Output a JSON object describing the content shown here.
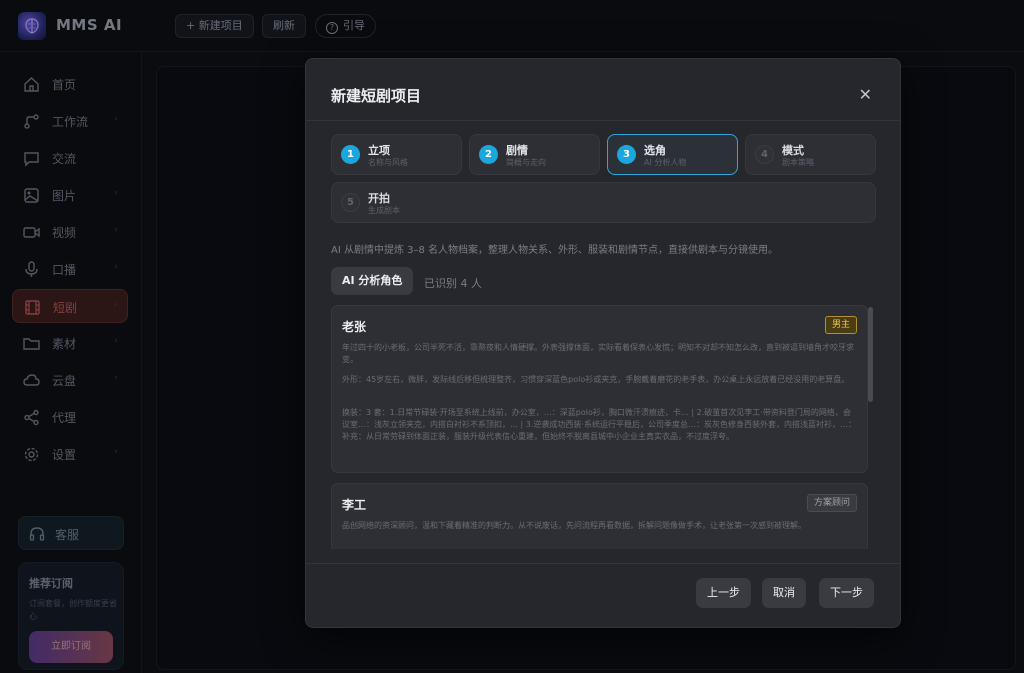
{
  "app": {
    "name": "MMS AI",
    "toolbar": {
      "new_project": "+ 新建项目",
      "refresh": "刷新",
      "guide": "引导"
    }
  },
  "sidebar": {
    "items": [
      {
        "label": "首页",
        "icon": "home-icon"
      },
      {
        "label": "工作流",
        "icon": "workflow-icon"
      },
      {
        "label": "交流",
        "icon": "chat-icon"
      },
      {
        "label": "图片",
        "icon": "image-icon"
      },
      {
        "label": "视频",
        "icon": "video-icon"
      },
      {
        "label": "口播",
        "icon": "microphone-icon"
      },
      {
        "label": "短剧",
        "icon": "film-icon",
        "active": true
      },
      {
        "label": "素材",
        "icon": "folder-icon"
      },
      {
        "label": "云盘",
        "icon": "cloud-icon"
      },
      {
        "label": "代理",
        "icon": "share-icon"
      },
      {
        "label": "设置",
        "icon": "gear-icon"
      }
    ],
    "service": "客服",
    "subscription": {
      "title": "推荐订阅",
      "desc": "订阅套餐，创作额度更省心",
      "button": "立即订阅"
    }
  },
  "modal": {
    "title": "新建短剧项目",
    "steps": [
      {
        "num": "1",
        "title": "立项",
        "sub": "名称与风格",
        "state": "done"
      },
      {
        "num": "2",
        "title": "剧情",
        "sub": "简概与走向",
        "state": "done"
      },
      {
        "num": "3",
        "title": "选角",
        "sub": "AI 分析人物",
        "state": "active"
      },
      {
        "num": "4",
        "title": "模式",
        "sub": "剧本策略",
        "state": "pending"
      },
      {
        "num": "5",
        "title": "开拍",
        "sub": "生成剧本",
        "state": "pending"
      }
    ],
    "intro": "AI 从剧情中提炼 3–8 名人物档案，整理人物关系、外形、服装和剧情节点，直接供剧本与分镜使用。",
    "tab_label": "AI 分析角色",
    "tab_count": "已识别 4 人",
    "characters": [
      {
        "name": "老张",
        "role": "男主",
        "bio": "年过四十的小老板，公司半死不活，靠熬夜和人情硬撑。外表强撑体面，实际看着保表心发慌；明知不对却不知怎么改，直到被逼到墙角才咬牙求变。",
        "look": "外形：45岁左右，微胖，发际线后移但梳理整齐，习惯穿深蓝色polo衫或夹克，手腕戴着磨花的老手表，办公桌上永远放着已经没用的老算盘。",
        "costume": "换装：3 套：1.日常节碌装·开场至系统上线前，办公室，…：深蓝polo衫，胸口微汗渍痕迹，卡… | 2.破茧首次见李工·带资料登门局的网络，会议室…：浅灰立领夹克，内搭白衬衫不系顶扣，… | 3.逆袭成功西装·系统运行平稳后，公司季度总…：炭灰色修身西装外套，内搭浅蓝衬衫，…：补充：从日常劳碌到体面正装，服装升级代表信心重建，但始终不脱离县城中小企业主真实衣品，不过度浮夸。"
      },
      {
        "name": "李工",
        "role": "方案顾问",
        "bio": "品创网络的资深顾问，温和下藏着精准的判断力。从不说废话，先问流程再看数据，拆解问题像做手术，让老张第一次感到被理解。"
      }
    ],
    "buttons": {
      "prev": "上一步",
      "cancel": "取消",
      "next": "下一步"
    }
  },
  "colors": {
    "accent": "#1aa7de",
    "active_nav": "#b05656",
    "badge_gold": "#f0c94a",
    "modal_bg": "#26272c"
  }
}
